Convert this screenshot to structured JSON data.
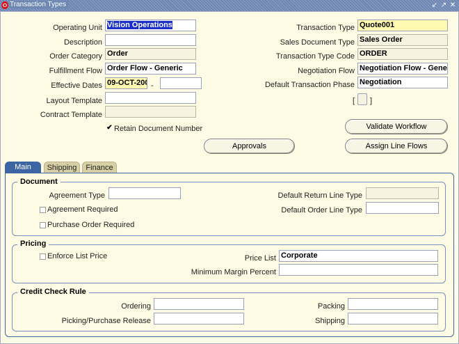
{
  "window": {
    "title": "Transaction Types",
    "controls": [
      "↙",
      "↗",
      "✕"
    ]
  },
  "header": {
    "operating_unit": {
      "label": "Operating Unit",
      "value": "Vision Operations"
    },
    "description": {
      "label": "Description",
      "value": ""
    },
    "order_category": {
      "label": "Order Category",
      "value": "Order"
    },
    "fulfillment_flow": {
      "label": "Fulfillment Flow",
      "value": "Order Flow - Generic"
    },
    "effective_dates": {
      "label": "Effective Dates",
      "from": "09-OCT-200",
      "separator": "-",
      "to": ""
    },
    "layout_template": {
      "label": "Layout Template",
      "value": ""
    },
    "contract_template": {
      "label": "Contract Template",
      "value": ""
    },
    "retain_document_number": {
      "label": "Retain Document Number",
      "checked": true
    },
    "transaction_type": {
      "label": "Transaction Type",
      "value": "Quote001"
    },
    "sales_document_type": {
      "label": "Sales Document Type",
      "value": "Sales Order"
    },
    "transaction_type_code": {
      "label": "Transaction Type Code",
      "value": "ORDER"
    },
    "negotiation_flow": {
      "label": "Negotiation Flow",
      "value": "Negotiation Flow - Gene"
    },
    "default_transaction_phase": {
      "label": "Default Transaction Phase",
      "value": "Negotiation"
    },
    "flex_open": "[",
    "flex_close": "]"
  },
  "buttons": {
    "validate_workflow": "Validate Workflow",
    "approvals": "Approvals",
    "assign_line_flows": "Assign Line  Flows"
  },
  "tabs": [
    {
      "label": "Main",
      "active": true
    },
    {
      "label": "Shipping",
      "active": false
    },
    {
      "label": "Finance",
      "active": false
    }
  ],
  "document": {
    "title": "Document",
    "agreement_type": {
      "label": "Agreement Type",
      "value": ""
    },
    "agreement_required": {
      "label": "Agreement Required",
      "checked": false
    },
    "purchase_order_required": {
      "label": "Purchase Order Required",
      "checked": false
    },
    "default_return_line_type": {
      "label": "Default Return Line Type",
      "value": ""
    },
    "default_order_line_type": {
      "label": "Default Order Line Type",
      "value": ""
    }
  },
  "pricing": {
    "title": "Pricing",
    "enforce_list_price": {
      "label": "Enforce List Price",
      "checked": false
    },
    "price_list": {
      "label": "Price List",
      "value": "Corporate"
    },
    "minimum_margin_percent": {
      "label": "Minimum Margin Percent",
      "value": ""
    }
  },
  "credit_check_rule": {
    "title": "Credit Check Rule",
    "ordering": {
      "label": "Ordering",
      "value": ""
    },
    "picking_purchase_release": {
      "label": "Picking/Purchase Release",
      "value": ""
    },
    "packing": {
      "label": "Packing",
      "value": ""
    },
    "shipping": {
      "label": "Shipping",
      "value": ""
    }
  },
  "colors": {
    "title_bar": "#6f87b3",
    "form_bg": "#fdfbe3",
    "tab_active": "#3b66a3",
    "required_field": "#fffab0",
    "selection": "#1b2fc9"
  },
  "icons": {
    "app": "oracle-logo-icon",
    "minimize": "minimize-icon",
    "maximize": "maximize-icon",
    "close": "close-icon",
    "checkbox": "checkbox-icon"
  }
}
